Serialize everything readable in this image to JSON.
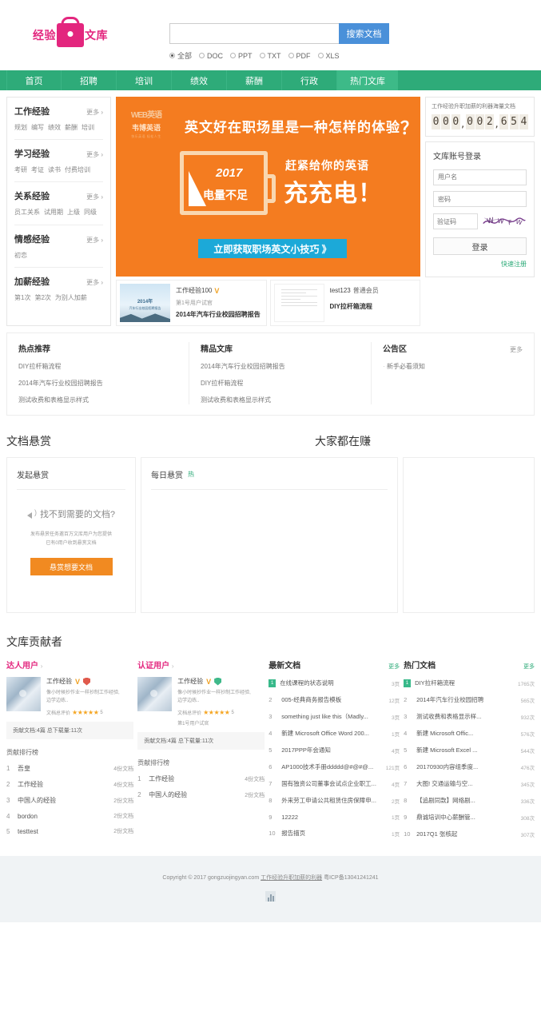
{
  "site": {
    "logo_left": "经验",
    "logo_right": "文库"
  },
  "search": {
    "placeholder": "",
    "value": "",
    "button": "搜索文档",
    "types": [
      "全部",
      "DOC",
      "PPT",
      "TXT",
      "PDF",
      "XLS"
    ],
    "selected_type": "全部"
  },
  "nav": {
    "items": [
      "首页",
      "招聘",
      "培训",
      "绩效",
      "薪酬",
      "行政",
      "热门文库"
    ],
    "active": "热门文库"
  },
  "categories": [
    {
      "title": "工作经验",
      "more": "更多 ›",
      "tags": [
        "规划",
        "编写",
        "绩效",
        "薪酬",
        "培训"
      ]
    },
    {
      "title": "学习经验",
      "more": "更多 ›",
      "tags": [
        "考研",
        "考证",
        "读书",
        "付费培训"
      ]
    },
    {
      "title": "关系经验",
      "more": "更多 ›",
      "tags": [
        "员工关系",
        "试用期",
        "上级",
        "同级"
      ]
    },
    {
      "title": "情感经验",
      "more": "更多 ›",
      "tags": [
        "初恋"
      ]
    },
    {
      "title": "加薪经验",
      "more": "更多 ›",
      "tags": [
        "第1次",
        "第2次",
        "为别人加薪"
      ]
    }
  ],
  "banner": {
    "brand_line1": "WEB英语",
    "brand_line2": "韦博英语",
    "brand_line3": "快乐英语 轻松人生",
    "question": "英文好在职场里是一种怎样的体验",
    "question_mark": "？",
    "year": "2017",
    "low_power": "电量不足",
    "right_line1": "赶紧给你的英语",
    "right_line2": "充充电！",
    "cta": "立即获取职场英文小技巧 》"
  },
  "doc_cards": [
    {
      "user": "工作经验100",
      "subtitle": "第1号用户试官",
      "title": "2014年汽车行业校园招聘报告",
      "thumb_title": "2014年",
      "thumb_sub": "汽车行业校园招聘报告"
    },
    {
      "user": "test123",
      "member": "普通会员",
      "title": "DIY拉杆箱流程"
    }
  ],
  "counter": {
    "label": "工作经验升职加薪的利器海量文档",
    "digits": [
      "0",
      "0",
      "0",
      ",",
      "0",
      "0",
      "2",
      ",",
      "6",
      "5",
      "4"
    ]
  },
  "login": {
    "title": "文库账号登录",
    "username_placeholder": "用户名",
    "password_placeholder": "密码",
    "captcha_placeholder": "验证码",
    "button": "登录",
    "register": "快速注册"
  },
  "link_columns": [
    {
      "title": "热点推荐",
      "more": "",
      "items": [
        "DIY拉杆箱流程",
        "2014年汽车行业校园招聘报告",
        "测试收费和表格显示样式"
      ]
    },
    {
      "title": "精品文库",
      "more": "",
      "items": [
        "2014年汽车行业校园招聘报告",
        "DIY拉杆箱流程",
        "测试收费和表格显示样式"
      ]
    },
    {
      "title": "公告区",
      "more": "更多",
      "items": [
        "新手必看须知"
      ]
    }
  ],
  "bounty": {
    "section_title": "文档悬赏",
    "earn_title": "大家都在赚",
    "create_title": "发起悬赏",
    "question": "找不到需要的文档?",
    "desc_line1": "发布悬赏任务邀百万文库用户为您提供",
    "desc_line2": "已有0用户收到悬赏文档",
    "button": "悬赏想要文档",
    "daily_title": "每日悬赏",
    "daily_hot": "热"
  },
  "contributors": {
    "section_title": "文库贡献者",
    "columns": [
      {
        "head": "达人用户",
        "chevron": "›",
        "name": "工作经验",
        "desc_line1": "像小时候抄作业一样抄制工作经验,",
        "desc_line2": "边学边练..",
        "rate_label": "文档总评价",
        "stars": "★★★★★",
        "rate_value": "5",
        "extra": "",
        "stat": "贡献文档:4篇  总下载量:11次",
        "rank_head": "贡献排行榜",
        "rank": [
          {
            "n": "1",
            "name": "吾皇",
            "value": "4份文档"
          },
          {
            "n": "2",
            "name": "工作经验",
            "value": "4份文档"
          },
          {
            "n": "3",
            "name": "中国人的经验",
            "value": "2份文档"
          },
          {
            "n": "4",
            "name": "bordon",
            "value": "2份文档"
          },
          {
            "n": "5",
            "name": "testtest",
            "value": "2份文档"
          }
        ]
      },
      {
        "head": "认证用户",
        "chevron": "›",
        "name": "工作经验",
        "desc_line1": "像小时候抄作业一样抄制工作经验,",
        "desc_line2": "边学边练..",
        "rate_label": "文档总评价",
        "stars": "★★★★★",
        "rate_value": "5",
        "extra": "第1号用户试官",
        "stat": "贡献文档:4篇  总下载量:11次",
        "rank_head": "贡献排行榜",
        "rank": [
          {
            "n": "1",
            "name": "工作经验",
            "value": "4份文档"
          },
          {
            "n": "2",
            "name": "中国人的经验",
            "value": "2份文档"
          }
        ]
      }
    ],
    "latest": {
      "title": "最新文档",
      "more": "更多",
      "items": [
        {
          "n": "1",
          "title": "在线课程的状态说明",
          "value": "3页"
        },
        {
          "n": "2",
          "title": "005-经典商务报告模板",
          "value": "12页"
        },
        {
          "n": "3",
          "title": "something just like this（Madly...",
          "value": "3页"
        },
        {
          "n": "4",
          "title": "新建 Microsoft Office Word 200...",
          "value": "1页"
        },
        {
          "n": "5",
          "title": "2017PPP年会通知",
          "value": "4页"
        },
        {
          "n": "6",
          "title": "AP1000技术手册ddddd@#@#@...",
          "value": "121页"
        },
        {
          "n": "7",
          "title": "国有独资公司董事会试点企业职工...",
          "value": "4页"
        },
        {
          "n": "8",
          "title": "外来劳工申请公共租赁住房保障申...",
          "value": "2页"
        },
        {
          "n": "9",
          "title": "12222",
          "value": "1页"
        },
        {
          "n": "10",
          "title": "报告描页",
          "value": "1页"
        }
      ]
    },
    "hot": {
      "title": "热门文档",
      "more": "更多",
      "items": [
        {
          "n": "1",
          "title": "DIY拉杆箱流程",
          "value": "1765次"
        },
        {
          "n": "2",
          "title": "2014年汽车行业校园招聘",
          "value": "565次"
        },
        {
          "n": "3",
          "title": "测试收费和表格显示样...",
          "value": "932次"
        },
        {
          "n": "4",
          "title": "新建 Microsoft Offic...",
          "value": "576次"
        },
        {
          "n": "5",
          "title": "新建 Microsoft Excel ...",
          "value": "544次"
        },
        {
          "n": "6",
          "title": "20170930内容组季度...",
          "value": "476次"
        },
        {
          "n": "7",
          "title": "大图! 交通运输与空...",
          "value": "345次"
        },
        {
          "n": "8",
          "title": "【追剧同款】网络剧...",
          "value": "336次"
        },
        {
          "n": "9",
          "title": "鼎诚培训中心薪酬管...",
          "value": "308次"
        },
        {
          "n": "10",
          "title": "2017Q1 张核起",
          "value": "307次"
        }
      ]
    }
  },
  "footer": {
    "copyright": "Copyright © 2017 gongzuojingyan.com",
    "link": "工作经验升职加薪的利器",
    "icp": "粤ICP备13041241241"
  },
  "colors": {
    "brand_pink": "#e3267e",
    "nav_green": "#2eab79",
    "search_blue": "#4a90d9",
    "banner_orange": "#f47c20",
    "cta_blue": "#1ca9d8",
    "bounty_orange": "#f18a21"
  }
}
